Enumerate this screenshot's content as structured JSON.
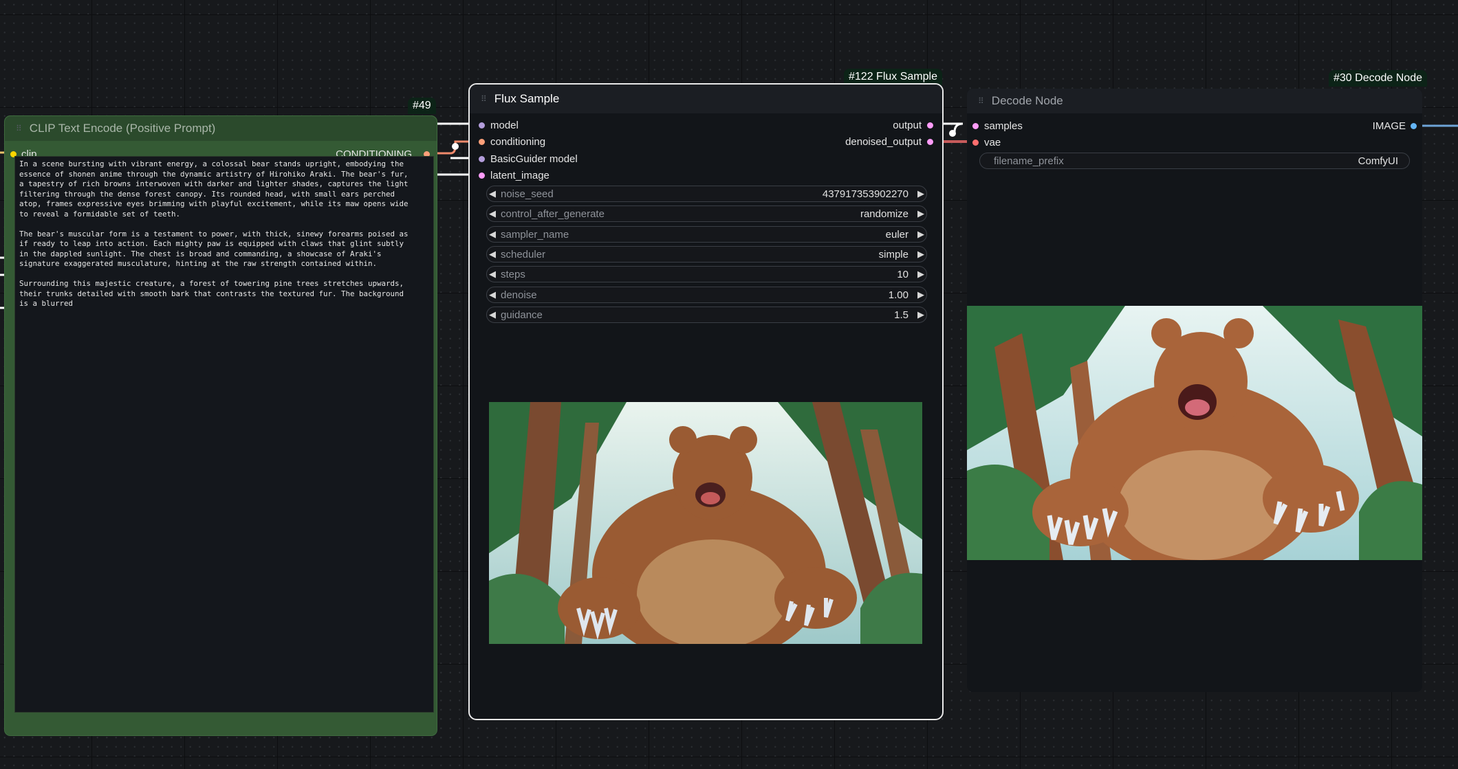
{
  "canvas": {
    "background": "#17191c"
  },
  "clip_node": {
    "id_badge": "#49",
    "title": "CLIP Text Encode (Positive Prompt)",
    "input_clip": "clip",
    "output_conditioning": "CONDITIONING",
    "prompt_text": "In a scene bursting with vibrant energy, a colossal bear stands upright, embodying the\nessence of shonen anime through the dynamic artistry of Hirohiko Araki. The bear's fur,\na tapestry of rich browns interwoven with darker and lighter shades, captures the light\nfiltering through the dense forest canopy. Its rounded head, with small ears perched\natop, frames expressive eyes brimming with playful excitement, while its maw opens wide\nto reveal a formidable set of teeth.\n\nThe bear's muscular form is a testament to power, with thick, sinewy forearms poised as\nif ready to leap into action. Each mighty paw is equipped with claws that glint subtly\nin the dappled sunlight. The chest is broad and commanding, a showcase of Araki's\nsignature exaggerated musculature, hinting at the raw strength contained within.\n\nSurrounding this majestic creature, a forest of towering pine trees stretches upwards,\ntheir trunks detailed with smooth bark that contrasts the textured fur. The background\nis a blurred",
    "color": "#2f5130"
  },
  "flux_node": {
    "id_badge": "#122 Flux Sample",
    "title": "Flux Sample",
    "inputs": [
      "model",
      "conditioning",
      "BasicGuider model",
      "latent_image"
    ],
    "outputs": [
      "output",
      "denoised_output"
    ],
    "widgets": [
      {
        "label": "noise_seed",
        "value": "437917353902270"
      },
      {
        "label": "control_after_generate",
        "value": "randomize"
      },
      {
        "label": "sampler_name",
        "value": "euler"
      },
      {
        "label": "scheduler",
        "value": "simple"
      },
      {
        "label": "steps",
        "value": "10"
      },
      {
        "label": "denoise",
        "value": "1.00"
      },
      {
        "label": "guidance",
        "value": "1.5"
      }
    ],
    "arrow_left": "◀",
    "arrow_right": "▶"
  },
  "decode_node": {
    "id_badge": "#30 Decode Node",
    "title": "Decode Node",
    "inputs": [
      "samples",
      "vae"
    ],
    "output_image": "IMAGE",
    "filename_prefix_label": "filename_prefix",
    "filename_prefix_value": "ComfyUI"
  },
  "colors": {
    "slot_model": "#b39ddb",
    "slot_conditioning": "#ffa07a",
    "slot_clip": "#ffd500",
    "slot_latent": "#ff9cf9",
    "slot_vae": "#ff6e6e",
    "slot_image": "#64b5f6"
  },
  "icons": [
    "drag-grip-icon",
    "arrow-left-icon",
    "arrow-right-icon"
  ]
}
